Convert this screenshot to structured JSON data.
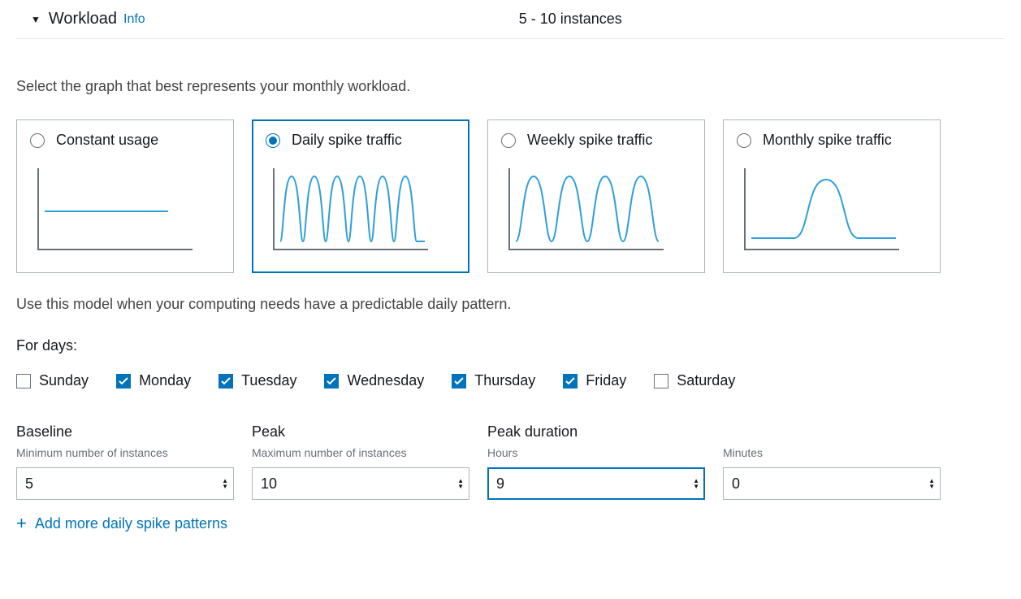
{
  "header": {
    "title": "Workload",
    "info_label": "Info",
    "instances_range": "5 - 10 instances"
  },
  "prompt": "Select the graph that best represents your monthly workload.",
  "options": {
    "constant": "Constant usage",
    "daily": "Daily spike traffic",
    "weekly": "Weekly spike traffic",
    "monthly": "Monthly spike traffic",
    "selected": "daily"
  },
  "model_description": "Use this model when your computing needs have a predictable daily pattern.",
  "for_days_label": "For days:",
  "days": [
    {
      "label": "Sunday",
      "checked": false
    },
    {
      "label": "Monday",
      "checked": true
    },
    {
      "label": "Tuesday",
      "checked": true
    },
    {
      "label": "Wednesday",
      "checked": true
    },
    {
      "label": "Thursday",
      "checked": true
    },
    {
      "label": "Friday",
      "checked": true
    },
    {
      "label": "Saturday",
      "checked": false
    }
  ],
  "inputs": {
    "baseline": {
      "title": "Baseline",
      "subtitle": "Minimum number of instances",
      "value": "5"
    },
    "peak": {
      "title": "Peak",
      "subtitle": "Maximum number of instances",
      "value": "10"
    },
    "hours": {
      "title": "Peak duration",
      "subtitle": "Hours",
      "value": "9"
    },
    "minutes": {
      "title": "",
      "subtitle": "Minutes",
      "value": "0"
    }
  },
  "add_more_label": "Add more daily spike patterns"
}
